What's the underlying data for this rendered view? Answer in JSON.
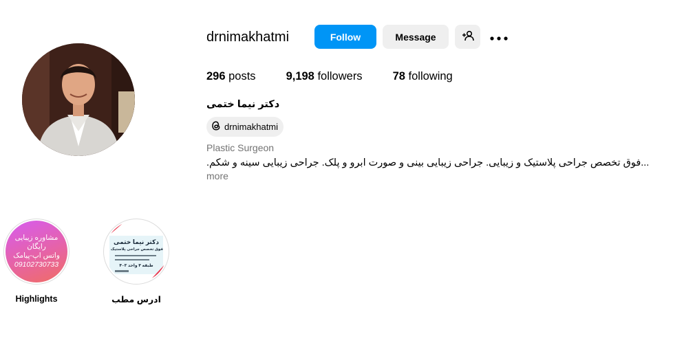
{
  "profile": {
    "username": "drnimakhatmi",
    "full_name": "دکتر نیما ختمی",
    "threads_handle": "drnimakhatmi",
    "category": "Plastic Surgeon",
    "bio": "...فوق تخصص جراحی پلاستیک و زیبایی. جراحی زیبایی بینی و صورت ابرو و پلک. جراحی زیبایی سینه و شکم.",
    "more_label": "more"
  },
  "actions": {
    "follow_label": "Follow",
    "message_label": "Message",
    "add_user_icon": "person-add-icon",
    "more_icon": "more-horizontal-icon"
  },
  "stats": [
    {
      "value": "296",
      "label": "posts"
    },
    {
      "value": "9,198",
      "label": "followers"
    },
    {
      "value": "78",
      "label": "following"
    }
  ],
  "highlights": [
    {
      "label": "Highlights",
      "cover_lines": [
        "مشاوره زیبایی",
        "رایگان",
        "واتس اپ-پیامک",
        "09102730733"
      ]
    },
    {
      "label": "ادرس مطب",
      "cover_lines": [
        "دکتر نیما ختمی",
        "فوق تخصص جراحی پلاستیک و زیبایی",
        "طبقه ۴ واحد ۴۰۳"
      ]
    }
  ],
  "colors": {
    "accent": "#0095f6",
    "button_gray": "#efefef",
    "secondary_text": "#737373"
  }
}
